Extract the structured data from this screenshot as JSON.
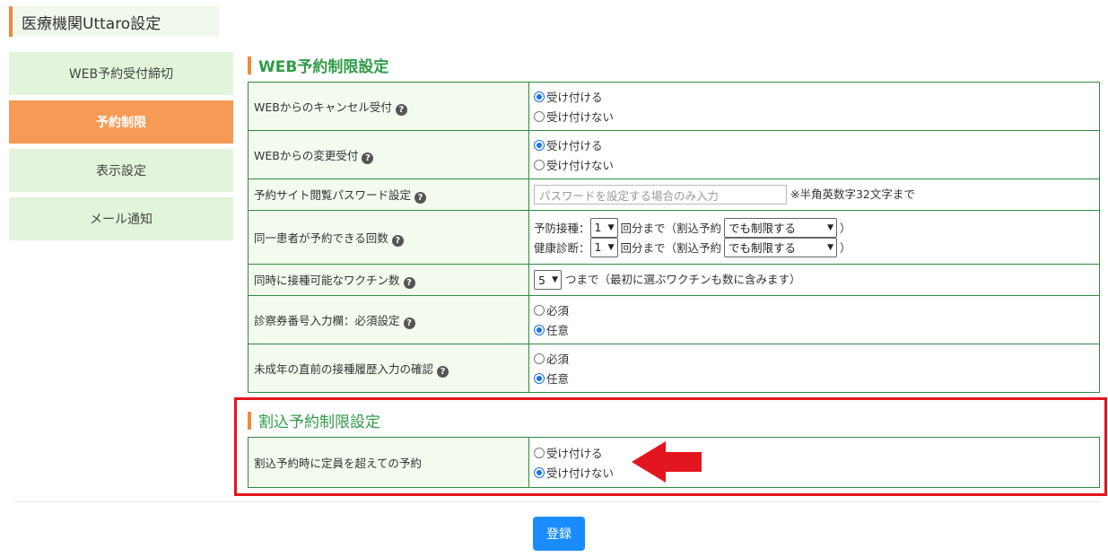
{
  "page": {
    "title": "医療機関Uttaro設定"
  },
  "sidebar": {
    "items": [
      {
        "label": "WEB予約受付締切"
      },
      {
        "label": "予約制限"
      },
      {
        "label": "表示設定"
      },
      {
        "label": "メール通知"
      }
    ],
    "active_index": 1
  },
  "web_section": {
    "title": "WEB予約制限設定",
    "rows": [
      {
        "label": "WEBからのキャンセル受付",
        "options": [
          "受け付ける",
          "受け付けない"
        ],
        "selected": "受け付ける"
      },
      {
        "label": "WEBからの変更受付",
        "options": [
          "受け付ける",
          "受け付けない"
        ],
        "selected": "受け付ける"
      },
      {
        "label": "予約サイト閲覧パスワード設定",
        "placeholder": "パスワードを設定する場合のみ入力",
        "note": "※半角英数字32文字まで"
      },
      {
        "label": "同一患者が予約できる回数",
        "lines": [
          {
            "prefix": "予防接種：",
            "count": "1",
            "mid": "回分まで（割込予約",
            "mode": "でも制限する",
            "suffix": "）"
          },
          {
            "prefix": "健康診断：",
            "count": "1",
            "mid": "回分まで（割込予約",
            "mode": "でも制限する",
            "suffix": "）"
          }
        ]
      },
      {
        "label": "同時に接種可能なワクチン数",
        "count": "5",
        "suffix": "つまで（最初に選ぶワクチンも数に含みます）"
      },
      {
        "label": "診察券番号入力欄：必須設定",
        "options": [
          "必須",
          "任意"
        ],
        "selected": "任意"
      },
      {
        "label": "未成年の直前の接種履歴入力の確認",
        "options": [
          "必須",
          "任意"
        ],
        "selected": "任意"
      }
    ]
  },
  "interrupt_section": {
    "title": "割込予約制限設定",
    "rows": [
      {
        "label": "割込予約時に定員を超えての予約",
        "options": [
          "受け付ける",
          "受け付けない"
        ],
        "selected": "受け付けない"
      }
    ]
  },
  "help_icon_glyph": "?",
  "submit": {
    "label": "登録"
  },
  "colors": {
    "accent_green": "#2e8b3d",
    "accent_orange": "#f79a55",
    "highlight_red": "#e3151e",
    "button_blue": "#1a8cff"
  }
}
